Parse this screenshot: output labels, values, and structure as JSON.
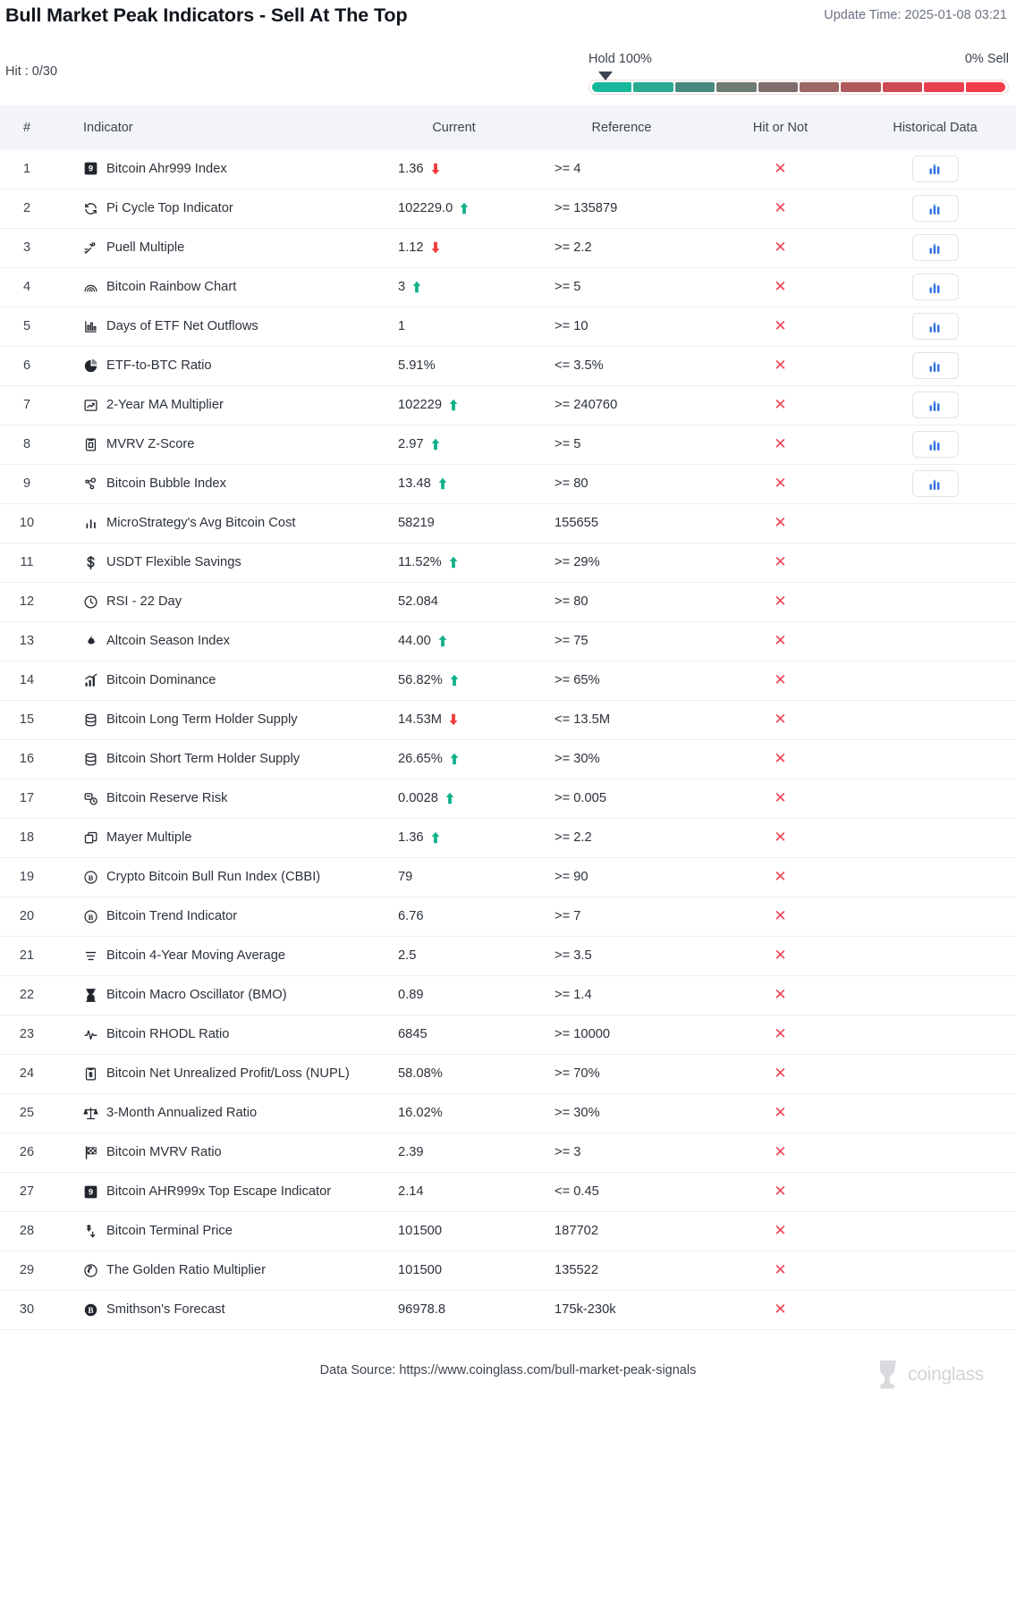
{
  "header": {
    "title": "Bull Market Peak Indicators - Sell At The Top",
    "update_time": "Update Time: 2025-01-08 03:21",
    "hit_count": "Hit : 0/30"
  },
  "gauge": {
    "left_label": "Hold 100%",
    "right_label": "0% Sell",
    "pointer_position_percent": 0,
    "segment_colors": [
      "#17b79b",
      "#2aab92",
      "#49897f",
      "#6f7c74",
      "#7e6e6c",
      "#9d6665",
      "#b15a5d",
      "#cd4b55",
      "#e8404f",
      "#f43c4c"
    ]
  },
  "table": {
    "columns": [
      "#",
      "Indicator",
      "Current",
      "Reference",
      "Hit or Not",
      "Historical Data"
    ],
    "rows": [
      {
        "num": "1",
        "icon": "ahr999-badge-icon",
        "indicator": "Bitcoin Ahr999 Index",
        "current": "1.36",
        "trend": "down",
        "reference": ">= 4",
        "hit": "✕",
        "history": true
      },
      {
        "num": "2",
        "icon": "cycle-refresh-icon",
        "indicator": "Pi Cycle Top Indicator",
        "current": "102229.0",
        "trend": "up",
        "reference": ">= 135879",
        "hit": "✕",
        "history": true
      },
      {
        "num": "3",
        "icon": "pickaxe-icon",
        "indicator": "Puell Multiple",
        "current": "1.12",
        "trend": "down",
        "reference": ">= 2.2",
        "hit": "✕",
        "history": true
      },
      {
        "num": "4",
        "icon": "rainbow-icon",
        "indicator": "Bitcoin Rainbow Chart",
        "current": "3",
        "trend": "up",
        "reference": ">= 5",
        "hit": "✕",
        "history": true
      },
      {
        "num": "5",
        "icon": "bar-chart-icon",
        "indicator": "Days of ETF Net Outflows",
        "current": "1",
        "trend": "none",
        "reference": ">= 10",
        "hit": "✕",
        "history": true
      },
      {
        "num": "6",
        "icon": "pie-chart-icon",
        "indicator": "ETF-to-BTC Ratio",
        "current": "5.91%",
        "trend": "none",
        "reference": "<= 3.5%",
        "hit": "✕",
        "history": true
      },
      {
        "num": "7",
        "icon": "line-chart-up-icon",
        "indicator": "2-Year MA Multiplier",
        "current": "102229",
        "trend": "up",
        "reference": ">= 240760",
        "hit": "✕",
        "history": true
      },
      {
        "num": "8",
        "icon": "clipboard-chart-icon",
        "indicator": "MVRV Z-Score",
        "current": "2.97",
        "trend": "up",
        "reference": ">= 5",
        "hit": "✕",
        "history": true
      },
      {
        "num": "9",
        "icon": "bubble-nodes-icon",
        "indicator": "Bitcoin Bubble Index",
        "current": "13.48",
        "trend": "up",
        "reference": ">= 80",
        "hit": "✕",
        "history": true
      },
      {
        "num": "10",
        "icon": "small-bars-icon",
        "indicator": "MicroStrategy's Avg Bitcoin Cost",
        "current": "58219",
        "trend": "none",
        "reference": "155655",
        "hit": "✕",
        "history": false
      },
      {
        "num": "11",
        "icon": "dollar-sign-icon",
        "indicator": "USDT Flexible Savings",
        "current": "11.52%",
        "trend": "up",
        "reference": ">= 29%",
        "hit": "✕",
        "history": false
      },
      {
        "num": "12",
        "icon": "clock-icon",
        "indicator": "RSI - 22 Day",
        "current": "52.084",
        "trend": "none",
        "reference": ">= 80",
        "hit": "✕",
        "history": false
      },
      {
        "num": "13",
        "icon": "flame-icon",
        "indicator": "Altcoin Season Index",
        "current": "44.00",
        "trend": "up",
        "reference": ">= 75",
        "hit": "✕",
        "history": false
      },
      {
        "num": "14",
        "icon": "growth-bars-icon",
        "indicator": "Bitcoin Dominance",
        "current": "56.82%",
        "trend": "up",
        "reference": ">= 65%",
        "hit": "✕",
        "history": false
      },
      {
        "num": "15",
        "icon": "database-icon",
        "indicator": "Bitcoin Long Term Holder Supply",
        "current": "14.53M",
        "trend": "down",
        "reference": "<= 13.5M",
        "hit": "✕",
        "history": false
      },
      {
        "num": "16",
        "icon": "database-icon",
        "indicator": "Bitcoin Short Term Holder Supply",
        "current": "26.65%",
        "trend": "up",
        "reference": ">= 30%",
        "hit": "✕",
        "history": false
      },
      {
        "num": "17",
        "icon": "reserve-risk-icon",
        "indicator": "Bitcoin Reserve Risk",
        "current": "0.0028",
        "trend": "up",
        "reference": ">= 0.005",
        "hit": "✕",
        "history": false
      },
      {
        "num": "18",
        "icon": "copy-layers-icon",
        "indicator": "Mayer Multiple",
        "current": "1.36",
        "trend": "up",
        "reference": ">= 2.2",
        "hit": "✕",
        "history": false
      },
      {
        "num": "19",
        "icon": "bitcoin-circle-icon",
        "indicator": "Crypto Bitcoin Bull Run Index (CBBI)",
        "current": "79",
        "trend": "none",
        "reference": ">= 90",
        "hit": "✕",
        "history": false
      },
      {
        "num": "20",
        "icon": "bitcoin-circle-icon",
        "indicator": "Bitcoin Trend Indicator",
        "current": "6.76",
        "trend": "none",
        "reference": ">= 7",
        "hit": "✕",
        "history": false
      },
      {
        "num": "21",
        "icon": "stacked-lines-icon",
        "indicator": "Bitcoin 4-Year Moving Average",
        "current": "2.5",
        "trend": "none",
        "reference": ">= 3.5",
        "hit": "✕",
        "history": false
      },
      {
        "num": "22",
        "icon": "hourglass-icon",
        "indicator": "Bitcoin Macro Oscillator (BMO)",
        "current": "0.89",
        "trend": "none",
        "reference": ">= 1.4",
        "hit": "✕",
        "history": false
      },
      {
        "num": "23",
        "icon": "pulse-icon",
        "indicator": "Bitcoin RHODL Ratio",
        "current": "6845",
        "trend": "none",
        "reference": ">= 10000",
        "hit": "✕",
        "history": false
      },
      {
        "num": "24",
        "icon": "clipboard-dollar-icon",
        "indicator": "Bitcoin Net Unrealized Profit/Loss (NUPL)",
        "current": "58.08%",
        "trend": "none",
        "reference": ">= 70%",
        "hit": "✕",
        "history": false
      },
      {
        "num": "25",
        "icon": "scales-icon",
        "indicator": "3-Month Annualized Ratio",
        "current": "16.02%",
        "trend": "none",
        "reference": ">= 30%",
        "hit": "✕",
        "history": false
      },
      {
        "num": "26",
        "icon": "checkered-flag-icon",
        "indicator": "Bitcoin MVRV Ratio",
        "current": "2.39",
        "trend": "none",
        "reference": ">= 3",
        "hit": "✕",
        "history": false
      },
      {
        "num": "27",
        "icon": "ahr999-badge-icon",
        "indicator": "Bitcoin AHR999x Top Escape Indicator",
        "current": "2.14",
        "trend": "none",
        "reference": "<= 0.45",
        "hit": "✕",
        "history": false
      },
      {
        "num": "28",
        "icon": "price-tag-down-icon",
        "indicator": "Bitcoin Terminal Price",
        "current": "101500",
        "trend": "none",
        "reference": "187702",
        "hit": "✕",
        "history": false
      },
      {
        "num": "29",
        "icon": "golden-ratio-icon",
        "indicator": "The Golden Ratio Multiplier",
        "current": "101500",
        "trend": "none",
        "reference": "135522",
        "hit": "✕",
        "history": false
      },
      {
        "num": "30",
        "icon": "bitcoin-solid-icon",
        "indicator": "Smithson's Forecast",
        "current": "96978.8",
        "trend": "none",
        "reference": "175k-230k",
        "hit": "✕",
        "history": false
      }
    ]
  },
  "footer": {
    "data_source": "Data Source: https://www.coinglass.com/bull-market-peak-signals",
    "brand_name": "coinglass"
  },
  "colors": {
    "up": "#11b18a",
    "down": "#ef3b3b",
    "miss": "#f04355",
    "header_bg": "#f2f4f7",
    "chart_blue": "#2f6fe0"
  }
}
